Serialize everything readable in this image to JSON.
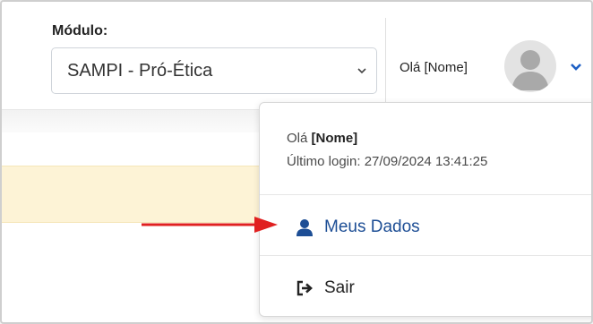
{
  "module": {
    "label": "Módulo:",
    "selected": "SAMPI - Pró-Ética"
  },
  "user_menu": {
    "greeting": "Olá [Nome]",
    "dropdown": {
      "hello_prefix": "Olá ",
      "name": "[Nome]",
      "last_login": "Último login: 27/09/2024 13:41:25",
      "items": [
        {
          "label": "Meus Dados",
          "icon": "user-icon"
        },
        {
          "label": "Sair",
          "icon": "sign-out-icon"
        }
      ]
    }
  },
  "colors": {
    "link_blue": "#1d4e95",
    "alert_bg": "#fdf3d6",
    "arrow_red": "#e02020"
  }
}
